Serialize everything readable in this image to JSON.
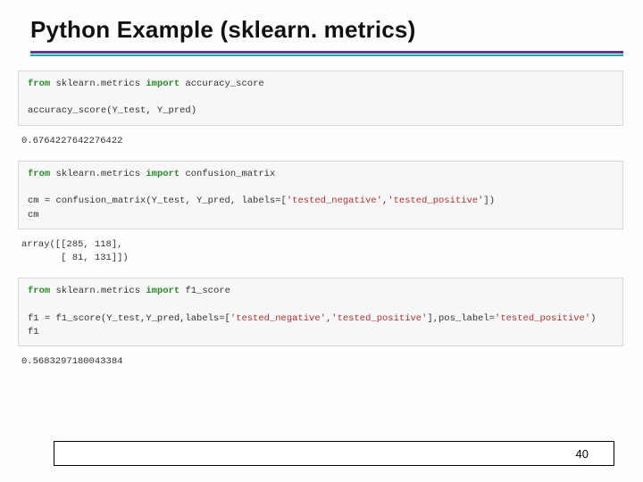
{
  "title": "Python Example (sklearn. metrics)",
  "cells": {
    "c1": {
      "kw_from": "from",
      "module": " sklearn.metrics ",
      "kw_import": "import",
      "name": " accuracy_score",
      "line2": "accuracy_score(Y_test, Y_pred)"
    },
    "out1": "0.6764227642276422",
    "c2": {
      "kw_from": "from",
      "module": " sklearn.metrics ",
      "kw_import": "import",
      "name": " confusion_matrix",
      "line2a": "cm = confusion_matrix(Y_test, Y_pred, labels=[",
      "line2s1": "'tested_negative'",
      "line2b": ",",
      "line2s2": "'tested_positive'",
      "line2c": "])",
      "line3": "cm"
    },
    "out2": "array([[285, 118],\n       [ 81, 131]])",
    "c3": {
      "kw_from": "from",
      "module": " sklearn.metrics ",
      "kw_import": "import",
      "name": " f1_score",
      "line2a": "f1 = f1_score(Y_test,Y_pred,labels=[",
      "line2s1": "'tested_negative'",
      "line2b": ",",
      "line2s2": "'tested_positive'",
      "line2c": "],pos_label=",
      "line2s3": "'tested_positive'",
      "line2d": ")",
      "line3": "f1"
    },
    "out3": "0.5683297180043384"
  },
  "page_number": "40"
}
